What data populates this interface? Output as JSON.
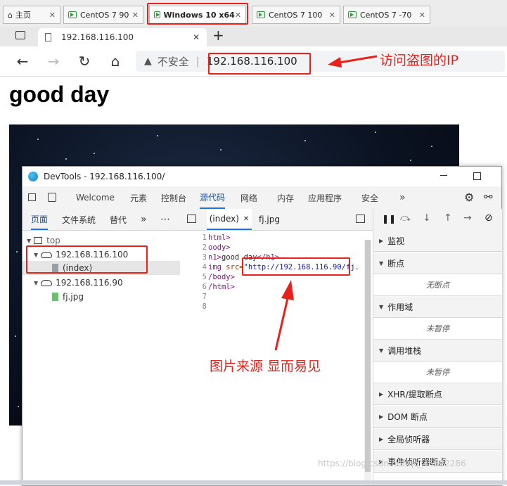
{
  "vm_tabs": [
    {
      "label": "主页",
      "icon": "home-icon"
    },
    {
      "label": "CentOS 7 90",
      "icon": "vm-icon"
    },
    {
      "label": "Windows 10 x64",
      "icon": "vm-icon",
      "active": true
    },
    {
      "label": "CentOS 7 100",
      "icon": "vm-icon"
    },
    {
      "label": "CentOS 7 -70",
      "icon": "vm-icon"
    }
  ],
  "browser": {
    "tab_title": "192.168.116.100",
    "new_tab": "+",
    "security_label": "不安全",
    "address": "192.168.116.100"
  },
  "page": {
    "heading": "good day"
  },
  "annotations": {
    "ip_note": "访问盗图的IP",
    "source_note": "图片来源 显而易见"
  },
  "devtools": {
    "title": "DevTools - 192.168.116.100/",
    "tabs": [
      "Welcome",
      "元素",
      "控制台",
      "源代码",
      "网络",
      "内存",
      "应用程序",
      "安全",
      "»"
    ],
    "active_tab": "源代码",
    "left_tabs": [
      "页面",
      "文件系统",
      "替代",
      "»",
      "⋯"
    ],
    "tree": {
      "root": "top",
      "host1": "192.168.116.100",
      "file1": "(index)",
      "host2": "192.168.116.90",
      "file2": "fj.jpg"
    },
    "editor_tabs": [
      "(index)",
      "fj.jpg"
    ],
    "code": {
      "lines": [
        "1",
        "2",
        "3",
        "4",
        "5",
        "6",
        "7",
        "8"
      ],
      "l1": "html>",
      "l2": "oody>",
      "l3_tag": "n1>",
      "l3_text": "good day",
      "l3_close": "</h1>",
      "l4_tag": "img",
      "l4_attr": "src=",
      "l4_url": "\"http://192.168.116.90/",
      "l4_tail": "fj.",
      "l5": "/body>",
      "l6": "/html>"
    },
    "right_sections": [
      {
        "label": "监视"
      },
      {
        "label": "断点",
        "note": "无断点"
      },
      {
        "label": "作用域",
        "note": "未暂停"
      },
      {
        "label": "调用堆栈",
        "note": "未暂停"
      },
      {
        "label": "XHR/提取断点"
      },
      {
        "label": "DOM 断点"
      },
      {
        "label": "全局侦听器"
      },
      {
        "label": "事件侦听器断点"
      }
    ]
  },
  "watermark": "https://blog.csdn.net/qq_45622286"
}
